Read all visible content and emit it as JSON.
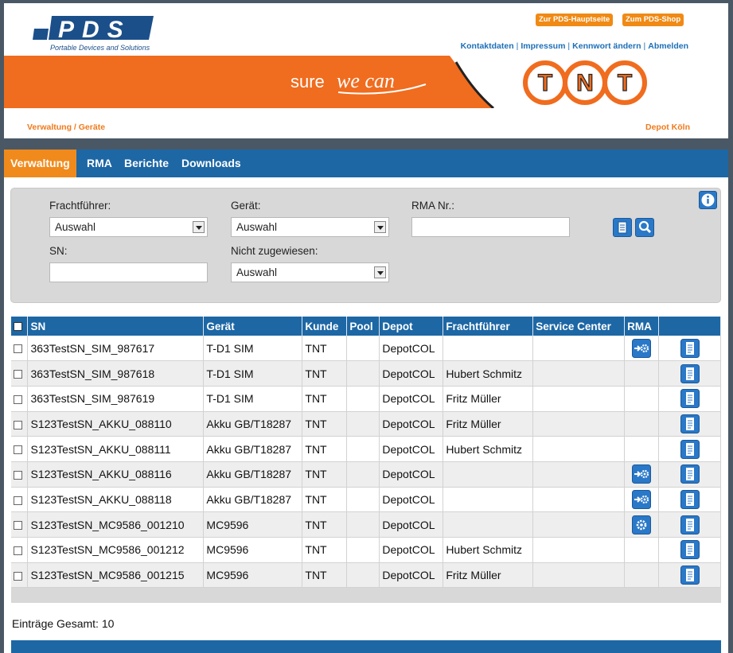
{
  "header": {
    "logo_text": "PDS",
    "logo_tagline": "Portable Devices and Solutions",
    "btn_hauptseite": "Zur PDS-Hauptseite",
    "btn_shop": "Zum PDS-Shop",
    "links": [
      "Kontaktdaten",
      "Impressum",
      "Kennwort ändern",
      "Abmelden"
    ],
    "slogan": "sure we can",
    "partner_logo": "TNT",
    "breadcrumb": "Verwaltung / Geräte",
    "depot": "Depot Köln"
  },
  "nav": {
    "items": [
      "Verwaltung",
      "RMA",
      "Berichte",
      "Downloads"
    ],
    "active": "Verwaltung"
  },
  "filter": {
    "frachtfuehrer_label": "Frachtführer:",
    "frachtfuehrer_value": "Auswahl",
    "geraet_label": "Gerät:",
    "geraet_value": "Auswahl",
    "rma_label": "RMA Nr.:",
    "rma_value": "",
    "sn_label": "SN:",
    "sn_value": "",
    "nicht_label": "Nicht zugewiesen:",
    "nicht_value": "Auswahl",
    "icons": [
      "info-icon",
      "export-icon",
      "search-icon"
    ]
  },
  "table": {
    "headers": [
      "SN",
      "Gerät",
      "Kunde",
      "Pool",
      "Depot",
      "Frachtführer",
      "Service Center",
      "RMA"
    ],
    "rows": [
      {
        "sn": "363TestSN_SIM_987617",
        "geraet": "T-D1 SIM",
        "kunde": "TNT",
        "pool": "",
        "depot": "DepotCOL",
        "fracht": "",
        "sc": "",
        "rma": "rma-forward-icon"
      },
      {
        "sn": "363TestSN_SIM_987618",
        "geraet": "T-D1 SIM",
        "kunde": "TNT",
        "pool": "",
        "depot": "DepotCOL",
        "fracht": "Hubert Schmitz",
        "sc": "",
        "rma": ""
      },
      {
        "sn": "363TestSN_SIM_987619",
        "geraet": "T-D1 SIM",
        "kunde": "TNT",
        "pool": "",
        "depot": "DepotCOL",
        "fracht": "Fritz Müller",
        "sc": "",
        "rma": ""
      },
      {
        "sn": "S123TestSN_AKKU_088110",
        "geraet": "Akku GB/T18287",
        "kunde": "TNT",
        "pool": "",
        "depot": "DepotCOL",
        "fracht": "Fritz Müller",
        "sc": "",
        "rma": ""
      },
      {
        "sn": "S123TestSN_AKKU_088111",
        "geraet": "Akku GB/T18287",
        "kunde": "TNT",
        "pool": "",
        "depot": "DepotCOL",
        "fracht": "Hubert Schmitz",
        "sc": "",
        "rma": ""
      },
      {
        "sn": "S123TestSN_AKKU_088116",
        "geraet": "Akku GB/T18287",
        "kunde": "TNT",
        "pool": "",
        "depot": "DepotCOL",
        "fracht": "",
        "sc": "",
        "rma": "rma-forward-icon"
      },
      {
        "sn": "S123TestSN_AKKU_088118",
        "geraet": "Akku GB/T18287",
        "kunde": "TNT",
        "pool": "",
        "depot": "DepotCOL",
        "fracht": "",
        "sc": "",
        "rma": "rma-forward-icon"
      },
      {
        "sn": "S123TestSN_MC9586_001210",
        "geraet": "MC9596",
        "kunde": "TNT",
        "pool": "",
        "depot": "DepotCOL",
        "fracht": "",
        "sc": "",
        "rma": "rma-gear-icon"
      },
      {
        "sn": "S123TestSN_MC9586_001212",
        "geraet": "MC9596",
        "kunde": "TNT",
        "pool": "",
        "depot": "DepotCOL",
        "fracht": "Hubert Schmitz",
        "sc": "",
        "rma": ""
      },
      {
        "sn": "S123TestSN_MC9586_001215",
        "geraet": "MC9596",
        "kunde": "TNT",
        "pool": "",
        "depot": "DepotCOL",
        "fracht": "Fritz Müller",
        "sc": "",
        "rma": ""
      }
    ]
  },
  "footer": {
    "total_label": "Einträge Gesamt: 10"
  },
  "colors": {
    "nav_blue": "#1d67a5",
    "accent_orange": "#f08a1c",
    "link_blue": "#1d6fb8",
    "tnt_orange": "#f07a1c"
  }
}
